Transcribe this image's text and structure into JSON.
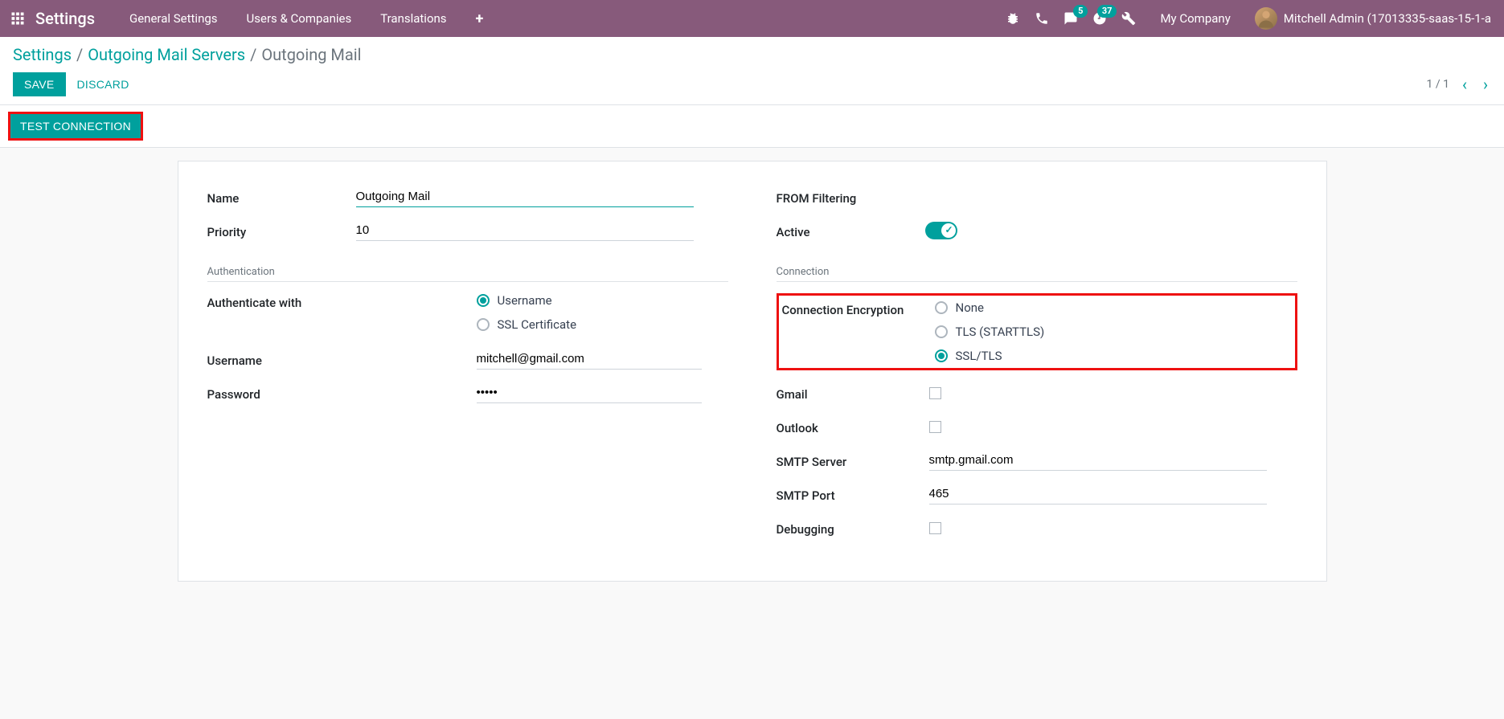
{
  "topnav": {
    "brand": "Settings",
    "menu": [
      "General Settings",
      "Users & Companies",
      "Translations"
    ],
    "messaging_badge": "5",
    "activities_badge": "37",
    "company": "My Company",
    "user": "Mitchell Admin (17013335-saas-15-1-a"
  },
  "breadcrumb": {
    "root": "Settings",
    "mid": "Outgoing Mail Servers",
    "current": "Outgoing Mail"
  },
  "buttons": {
    "save": "Save",
    "discard": "Discard",
    "test_connection": "Test Connection"
  },
  "pager": {
    "text": "1 / 1"
  },
  "form": {
    "left": {
      "name_label": "Name",
      "name_value": "Outgoing Mail",
      "priority_label": "Priority",
      "priority_value": "10",
      "auth_section": "Authentication",
      "auth_with_label": "Authenticate with",
      "auth_options": {
        "username": "Username",
        "ssl_cert": "SSL Certificate"
      },
      "username_label": "Username",
      "username_value": "mitchell@gmail.com",
      "password_label": "Password",
      "password_value": "•••••"
    },
    "right": {
      "from_filtering_label": "FROM Filtering",
      "active_label": "Active",
      "connection_section": "Connection",
      "conn_enc_label": "Connection Encryption",
      "enc_options": {
        "none": "None",
        "tls": "TLS (STARTTLS)",
        "ssl": "SSL/TLS"
      },
      "gmail_label": "Gmail",
      "outlook_label": "Outlook",
      "smtp_server_label": "SMTP Server",
      "smtp_server_value": "smtp.gmail.com",
      "smtp_port_label": "SMTP Port",
      "smtp_port_value": "465",
      "debugging_label": "Debugging"
    }
  }
}
